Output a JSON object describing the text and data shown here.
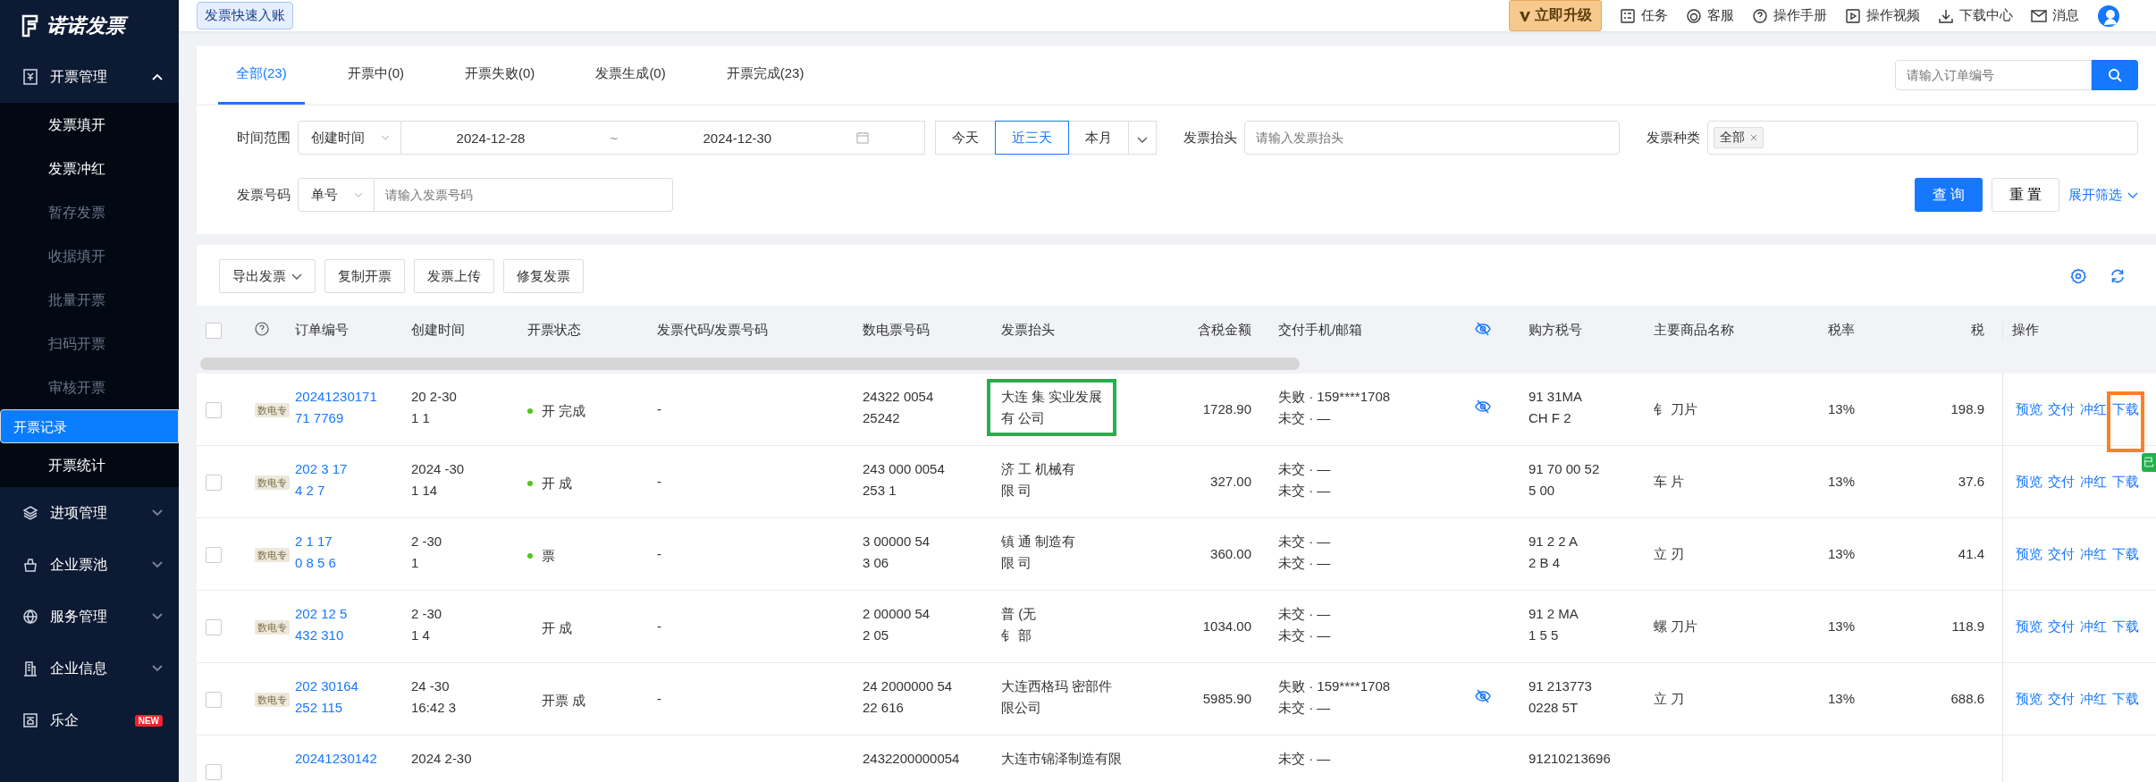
{
  "sidebar": {
    "logo": "诺诺发票",
    "groups": [
      {
        "label": "开票管理",
        "expanded": true,
        "children": [
          {
            "label": "发票填开",
            "selected": false,
            "disabled": false
          },
          {
            "label": "发票冲红",
            "selected": false,
            "disabled": false
          },
          {
            "label": "暂存发票",
            "selected": false,
            "disabled": true
          },
          {
            "label": "收据填开",
            "selected": false,
            "disabled": true
          },
          {
            "label": "批量开票",
            "selected": false,
            "disabled": true
          },
          {
            "label": "扫码开票",
            "selected": false,
            "disabled": true
          },
          {
            "label": "审核开票",
            "selected": false,
            "disabled": true
          },
          {
            "label": "开票记录",
            "selected": true,
            "disabled": false
          },
          {
            "label": "开票统计",
            "selected": false,
            "disabled": false
          }
        ]
      },
      {
        "label": "进项管理",
        "expanded": false
      },
      {
        "label": "企业票池",
        "expanded": false
      },
      {
        "label": "服务管理",
        "expanded": false
      },
      {
        "label": "企业信息",
        "expanded": false
      },
      {
        "label": "乐企",
        "badge": "NEW"
      }
    ]
  },
  "topbar": {
    "quick_tag": "发票快速入账",
    "upgrade": "立即升级",
    "links": [
      {
        "label": "任务"
      },
      {
        "label": "客服"
      },
      {
        "label": "操作手册"
      },
      {
        "label": "操作视频"
      },
      {
        "label": "下载中心"
      },
      {
        "label": "消息"
      }
    ]
  },
  "tabs": [
    {
      "label": "全部(23)",
      "selected": true
    },
    {
      "label": "开票中(0)",
      "selected": false
    },
    {
      "label": "开票失败(0)",
      "selected": false
    },
    {
      "label": "发票生成(0)",
      "selected": false
    },
    {
      "label": "开票完成(23)",
      "selected": false
    }
  ],
  "search": {
    "placeholder": "请输入订单编号"
  },
  "filters": {
    "time": {
      "label": "时间范围",
      "select": "创建时间",
      "start": "2024-12-28",
      "separator": "~",
      "end": "2024-12-30",
      "quick": [
        {
          "label": "今天",
          "selected": false
        },
        {
          "label": "近三天",
          "selected": true
        },
        {
          "label": "本月",
          "selected": false
        }
      ]
    },
    "title": {
      "label": "发票抬头",
      "placeholder": "请输入发票抬头"
    },
    "kind": {
      "label": "发票种类",
      "tags": [
        "全部"
      ]
    },
    "number": {
      "label": "发票号码",
      "select": "单号",
      "placeholder": "请输入发票号码"
    },
    "query": "查 询",
    "reset": "重 置",
    "expand": "展开筛选"
  },
  "toolbar": [
    {
      "label": "导出发票",
      "dropdown": true
    },
    {
      "label": "复制开票",
      "dropdown": false
    },
    {
      "label": "发票上传",
      "dropdown": false
    },
    {
      "label": "修复发票",
      "dropdown": false
    }
  ],
  "table": {
    "select_all_checked": false,
    "columns": [
      "订单编号",
      "创建时间",
      "开票状态",
      "发票代码/发票号码",
      "数电票号码",
      "发票抬头",
      "含税金额",
      "交付手机/邮箱",
      "购方税号",
      "主要商品名称",
      "税率",
      "税",
      "操作"
    ],
    "rows": [
      {
        "checked": false,
        "tag": "数电专",
        "order": [
          "20241230171",
          "71  7769"
        ],
        "created": [
          "20   2-30",
          "1  1"
        ],
        "status": "开  完成",
        "dot": true,
        "code": "-",
        "einv": [
          "24322   0054",
          "25242"
        ],
        "title": [
          "大连 集 实业发展",
          "有  公司"
        ],
        "outlined": true,
        "amount": "1728.90",
        "delivery": [
          "失败 · 159****1708",
          "未交 · —"
        ],
        "masked": true,
        "tax_id": [
          "91   31MA",
          "CH  F  2"
        ],
        "goods": "钅 刀片",
        "rate": "13%",
        "tax": "198.9",
        "actions": [
          {
            "label": "预览",
            "outlined": false
          },
          {
            "label": "交付",
            "outlined": false
          },
          {
            "label": "冲红",
            "outlined": false
          },
          {
            "label": "下载",
            "outlined": true
          }
        ]
      },
      {
        "checked": false,
        "tag": "数电专",
        "order": [
          "202  3 17",
          "4    2 7"
        ],
        "created": [
          "2024   -30",
          "1 14"
        ],
        "status": "开  成",
        "dot": true,
        "code": "-",
        "einv": [
          "243  000 0054",
          "253  1"
        ],
        "title": [
          "济    工 机械有",
          "限  司"
        ],
        "outlined": false,
        "amount": "327.00",
        "delivery": [
          "未交 · —",
          "未交 · —"
        ],
        "masked": false,
        "tax_id": [
          "91 70 00 52",
          "5  00"
        ],
        "goods": "车  片",
        "rate": "13%",
        "tax": "37.6",
        "actions": [
          {
            "label": "预览",
            "outlined": false
          },
          {
            "label": "交付",
            "outlined": false
          },
          {
            "label": "冲红",
            "outlined": false
          },
          {
            "label": "下载",
            "outlined": false
          }
        ]
      },
      {
        "checked": false,
        "tag": "数电专",
        "order": [
          "2  1  17",
          "0 8 5  6"
        ],
        "created": [
          "2    -30",
          "1"
        ],
        "status": "票",
        "dot": true,
        "code": "-",
        "einv": [
          "3  00000 54",
          "3  06"
        ],
        "title": [
          "镇 通   制造有",
          "限  司"
        ],
        "outlined": false,
        "amount": "360.00",
        "delivery": [
          "未交 · —",
          "未交 · —"
        ],
        "masked": false,
        "tax_id": [
          "91 2   2 A",
          "2  B 4"
        ],
        "goods": "立  刃",
        "rate": "13%",
        "tax": "41.4",
        "actions": [
          {
            "label": "预览",
            "outlined": false
          },
          {
            "label": "交付",
            "outlined": false
          },
          {
            "label": "冲红",
            "outlined": false
          },
          {
            "label": "下载",
            "outlined": false
          }
        ]
      },
      {
        "checked": false,
        "tag": "数电专",
        "order": [
          "202 12  5",
          "432 310"
        ],
        "created": [
          "2     -30",
          "1 4"
        ],
        "status": "开  成",
        "dot": false,
        "code": "-",
        "einv": [
          "2  00000  54",
          "2  05"
        ],
        "title": [
          "普    (无",
          "钅  部"
        ],
        "outlined": false,
        "amount": "1034.00",
        "delivery": [
          "未交 · —",
          "未交 · —"
        ],
        "masked": false,
        "tax_id": [
          "91 2   MA",
          "1  5 5"
        ],
        "goods": "螺  刀片",
        "rate": "13%",
        "tax": "118.9",
        "actions": [
          {
            "label": "预览",
            "outlined": false
          },
          {
            "label": "交付",
            "outlined": false
          },
          {
            "label": "冲红",
            "outlined": false
          },
          {
            "label": "下载",
            "outlined": false
          }
        ]
      },
      {
        "checked": false,
        "tag": "数电专",
        "order": [
          "202  30164",
          "252  115"
        ],
        "created": [
          "24   -30",
          "16:42 3"
        ],
        "status": "开票 成",
        "dot": false,
        "code": "-",
        "einv": [
          "24 2000000 54",
          "22  616"
        ],
        "title": [
          "大连西格玛  密部件",
          "限公司"
        ],
        "outlined": false,
        "amount": "5985.90",
        "delivery": [
          "失败 · 159****1708",
          "未交 · —"
        ],
        "masked": true,
        "tax_id": [
          "91  213773",
          "0228  5T"
        ],
        "goods": "立  刀",
        "rate": "13%",
        "tax": "688.6",
        "actions": [
          {
            "label": "预览",
            "outlined": false
          },
          {
            "label": "交付",
            "outlined": false
          },
          {
            "label": "冲红",
            "outlined": false
          },
          {
            "label": "下载",
            "outlined": false
          }
        ]
      },
      {
        "checked": false,
        "order": [
          "20241230142"
        ],
        "created": [
          "2024  2-30"
        ],
        "einv": [
          "2432200000054"
        ],
        "title": [
          "大连市锦泽制造有限"
        ],
        "outlined": false,
        "delivery": [
          "未交 · —"
        ],
        "tax_id": [
          "91210213696"
        ]
      }
    ]
  },
  "side_tab": "已"
}
